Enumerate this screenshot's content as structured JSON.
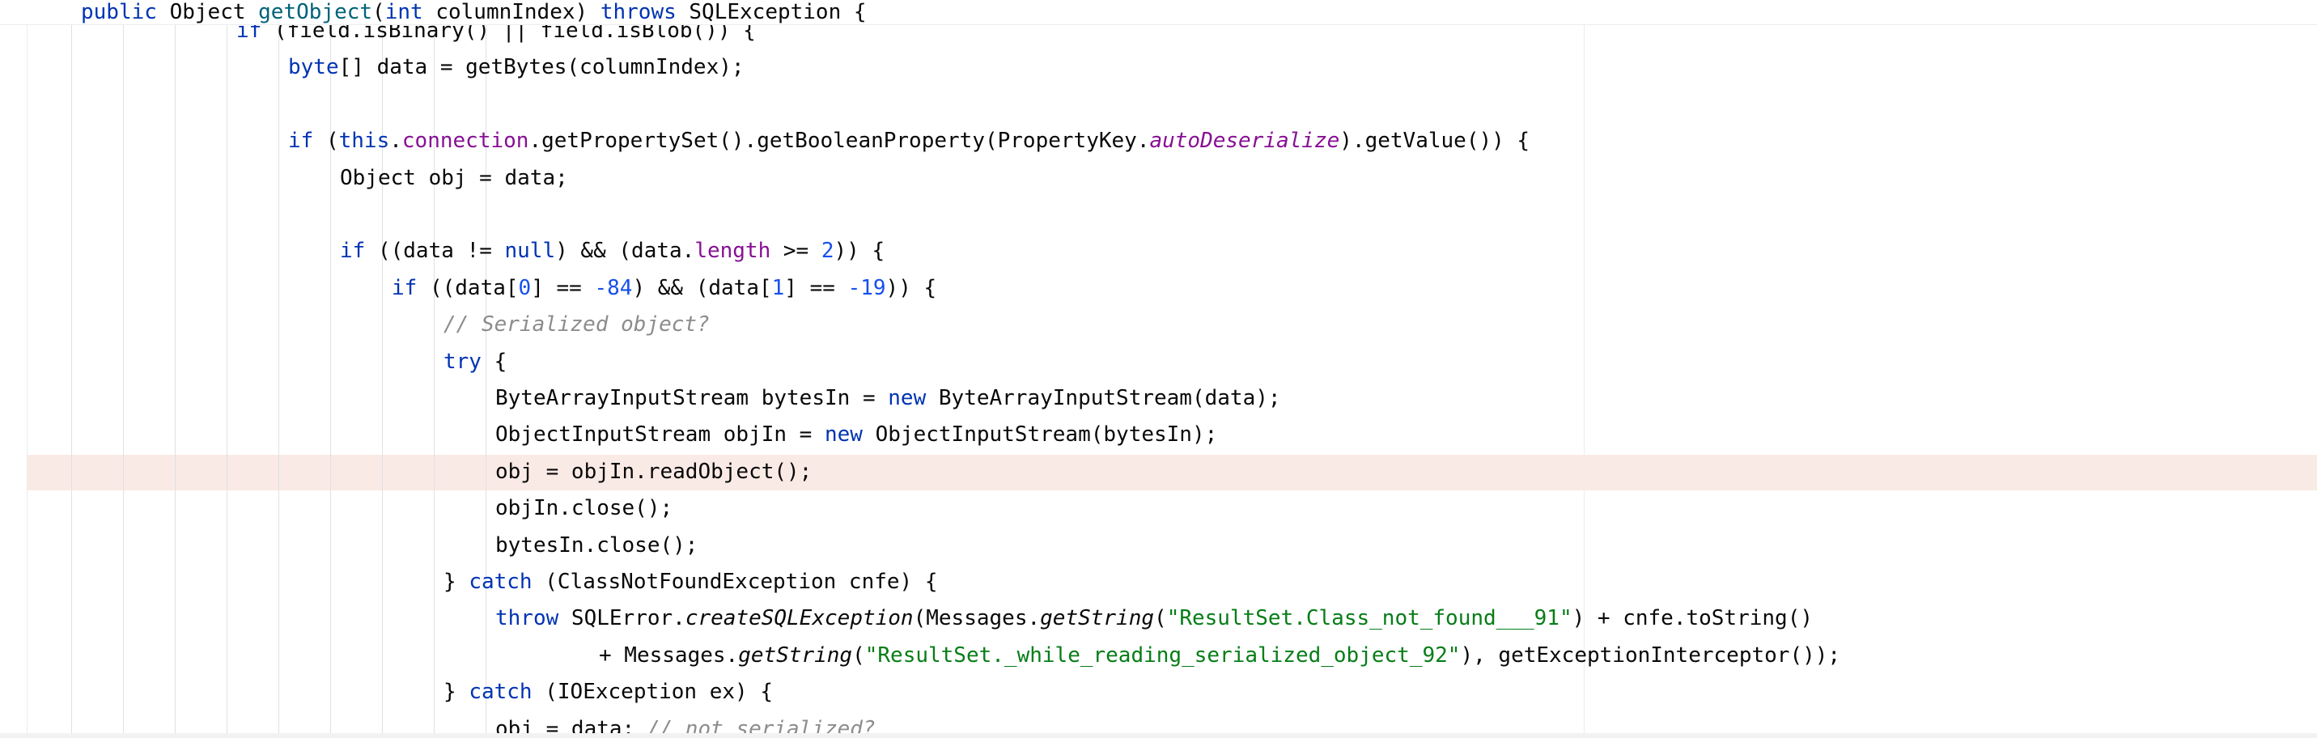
{
  "editor": {
    "sticky_header": [
      {
        "t": "public",
        "c": "kw"
      },
      {
        "t": " Object ",
        "c": "pl"
      },
      {
        "t": "getObject",
        "c": "fn"
      },
      {
        "t": "(",
        "c": "pl"
      },
      {
        "t": "int",
        "c": "kw"
      },
      {
        "t": " columnIndex) ",
        "c": "pl"
      },
      {
        "t": "throws",
        "c": "kw"
      },
      {
        "t": " SQLException {",
        "c": "pl"
      }
    ],
    "lines": [
      {
        "indent": 4,
        "tokens": [
          {
            "t": "if",
            "c": "kw"
          },
          {
            "t": " (field.isBinary() || field.isBlob()) {",
            "c": "pl"
          }
        ]
      },
      {
        "indent": 5,
        "tokens": [
          {
            "t": "byte",
            "c": "kw"
          },
          {
            "t": "[] data = getBytes(columnIndex);",
            "c": "pl"
          }
        ]
      },
      {
        "indent": 5,
        "tokens": []
      },
      {
        "indent": 5,
        "tokens": [
          {
            "t": "if",
            "c": "kw"
          },
          {
            "t": " (",
            "c": "pl"
          },
          {
            "t": "this",
            "c": "kw"
          },
          {
            "t": ".",
            "c": "pl"
          },
          {
            "t": "connection",
            "c": "fld"
          },
          {
            "t": ".getPropertySet().getBooleanProperty(PropertyKey.",
            "c": "pl"
          },
          {
            "t": "autoDeserialize",
            "c": "st"
          },
          {
            "t": ").getValue()) {",
            "c": "pl"
          }
        ]
      },
      {
        "indent": 6,
        "tokens": [
          {
            "t": "Object obj = data;",
            "c": "pl"
          }
        ]
      },
      {
        "indent": 6,
        "tokens": []
      },
      {
        "indent": 6,
        "tokens": [
          {
            "t": "if",
            "c": "kw"
          },
          {
            "t": " ((data != ",
            "c": "pl"
          },
          {
            "t": "null",
            "c": "kw"
          },
          {
            "t": ") && (data.",
            "c": "pl"
          },
          {
            "t": "length",
            "c": "fld"
          },
          {
            "t": " >= ",
            "c": "pl"
          },
          {
            "t": "2",
            "c": "num"
          },
          {
            "t": ")) {",
            "c": "pl"
          }
        ]
      },
      {
        "indent": 7,
        "tokens": [
          {
            "t": "if",
            "c": "kw"
          },
          {
            "t": " ((data[",
            "c": "pl"
          },
          {
            "t": "0",
            "c": "num"
          },
          {
            "t": "] == ",
            "c": "pl"
          },
          {
            "t": "-84",
            "c": "num"
          },
          {
            "t": ") && (data[",
            "c": "pl"
          },
          {
            "t": "1",
            "c": "num"
          },
          {
            "t": "] == ",
            "c": "pl"
          },
          {
            "t": "-19",
            "c": "num"
          },
          {
            "t": ")) {",
            "c": "pl"
          }
        ]
      },
      {
        "indent": 8,
        "tokens": [
          {
            "t": "// Serialized object?",
            "c": "cmt"
          }
        ]
      },
      {
        "indent": 8,
        "tokens": [
          {
            "t": "try",
            "c": "kw"
          },
          {
            "t": " {",
            "c": "pl"
          }
        ]
      },
      {
        "indent": 9,
        "tokens": [
          {
            "t": "ByteArrayInputStream bytesIn = ",
            "c": "pl"
          },
          {
            "t": "new",
            "c": "kw"
          },
          {
            "t": " ByteArrayInputStream(data);",
            "c": "pl"
          }
        ]
      },
      {
        "indent": 9,
        "tokens": [
          {
            "t": "ObjectInputStream objIn = ",
            "c": "pl"
          },
          {
            "t": "new",
            "c": "kw"
          },
          {
            "t": " ObjectInputStream(bytesIn);",
            "c": "pl"
          }
        ]
      },
      {
        "indent": 9,
        "tokens": [
          {
            "t": "obj = objIn.readObject();",
            "c": "pl"
          }
        ]
      },
      {
        "indent": 9,
        "tokens": [
          {
            "t": "objIn.close();",
            "c": "pl"
          }
        ]
      },
      {
        "indent": 9,
        "tokens": [
          {
            "t": "bytesIn.close();",
            "c": "pl"
          }
        ]
      },
      {
        "indent": 8,
        "tokens": [
          {
            "t": "} ",
            "c": "pl"
          },
          {
            "t": "catch",
            "c": "kw"
          },
          {
            "t": " (ClassNotFoundException cnfe) {",
            "c": "pl"
          }
        ]
      },
      {
        "indent": 9,
        "tokens": [
          {
            "t": "throw",
            "c": "kw"
          },
          {
            "t": " SQLError.",
            "c": "pl"
          },
          {
            "t": "createSQLException",
            "c": "it"
          },
          {
            "t": "(Messages.",
            "c": "pl"
          },
          {
            "t": "getString",
            "c": "it"
          },
          {
            "t": "(",
            "c": "pl"
          },
          {
            "t": "\"ResultSet.Class_not_found___91\"",
            "c": "str"
          },
          {
            "t": ") + cnfe.toString()",
            "c": "pl"
          }
        ]
      },
      {
        "indent": 11,
        "tokens": [
          {
            "t": "+ Messages.",
            "c": "pl"
          },
          {
            "t": "getString",
            "c": "it"
          },
          {
            "t": "(",
            "c": "pl"
          },
          {
            "t": "\"ResultSet._while_reading_serialized_object_92\"",
            "c": "str"
          },
          {
            "t": "), getExceptionInterceptor());",
            "c": "pl"
          }
        ]
      },
      {
        "indent": 8,
        "tokens": [
          {
            "t": "} ",
            "c": "pl"
          },
          {
            "t": "catch",
            "c": "kw"
          },
          {
            "t": " (IOException ex) {",
            "c": "pl"
          }
        ]
      },
      {
        "indent": 9,
        "tokens": [
          {
            "t": "obj = data; ",
            "c": "pl"
          },
          {
            "t": "// not serialized?",
            "c": "cmt"
          }
        ]
      }
    ]
  }
}
